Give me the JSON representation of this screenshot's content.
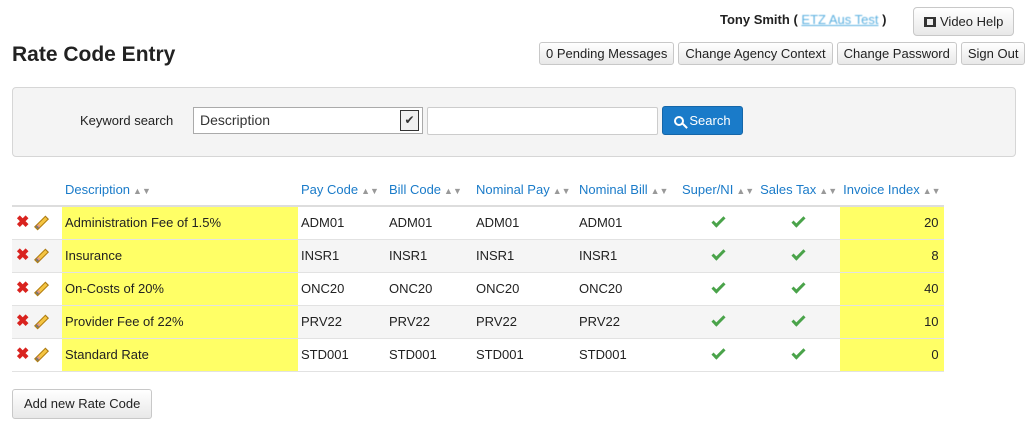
{
  "user": {
    "name": "Tony Smith",
    "open_paren": "(",
    "agency": "ETZ Aus Test",
    "close_paren": ")"
  },
  "video_help_label": "Video Help",
  "page_title": "Rate Code Entry",
  "top_actions": {
    "pending_messages": "0 Pending Messages",
    "change_agency": "Change Agency Context",
    "change_password": "Change Password",
    "sign_out": "Sign Out"
  },
  "search": {
    "label": "Keyword search",
    "field_selected": "Description",
    "input_value": "",
    "button_label": "Search"
  },
  "table": {
    "columns": [
      "Description",
      "Pay Code",
      "Bill Code",
      "Nominal Pay",
      "Nominal Bill",
      "Super/NI",
      "Sales Tax",
      "Invoice Index"
    ],
    "rows": [
      {
        "description": "Administration Fee of 1.5%",
        "pay_code": "ADM01",
        "bill_code": "ADM01",
        "nominal_pay": "ADM01",
        "nominal_bill": "ADM01",
        "super_ni": true,
        "sales_tax": true,
        "invoice_index": "20"
      },
      {
        "description": "Insurance",
        "pay_code": "INSR1",
        "bill_code": "INSR1",
        "nominal_pay": "INSR1",
        "nominal_bill": "INSR1",
        "super_ni": true,
        "sales_tax": true,
        "invoice_index": "8"
      },
      {
        "description": "On-Costs of 20%",
        "pay_code": "ONC20",
        "bill_code": "ONC20",
        "nominal_pay": "ONC20",
        "nominal_bill": "ONC20",
        "super_ni": true,
        "sales_tax": true,
        "invoice_index": "40"
      },
      {
        "description": "Provider Fee of 22%",
        "pay_code": "PRV22",
        "bill_code": "PRV22",
        "nominal_pay": "PRV22",
        "nominal_bill": "PRV22",
        "super_ni": true,
        "sales_tax": true,
        "invoice_index": "10"
      },
      {
        "description": "Standard Rate",
        "pay_code": "STD001",
        "bill_code": "STD001",
        "nominal_pay": "STD001",
        "nominal_bill": "STD001",
        "super_ni": true,
        "sales_tax": true,
        "invoice_index": "0"
      }
    ]
  },
  "add_button_label": "Add new Rate Code",
  "icons": {
    "delete": "delete-x-icon",
    "edit": "pencil-icon",
    "check": "check-icon",
    "sort": "sort-arrows-icon",
    "search": "magnifier-icon",
    "video": "film-icon"
  },
  "colors": {
    "link": "#1a7bc9",
    "highlight": "#ffff66",
    "check": "#4aa34a",
    "delete": "#d9231f",
    "primary_button": "#1a7bc9"
  }
}
